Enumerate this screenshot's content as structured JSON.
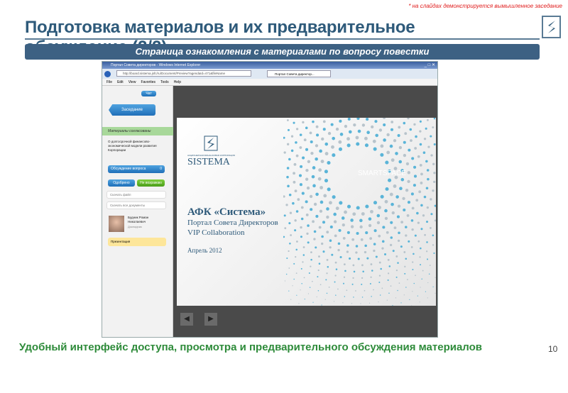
{
  "note": "* на слайдах демонстрируется вымышленное заседание",
  "title_line1": "Подготовка материалов и их предварительное",
  "title_line2": "обсуждение (2/2)",
  "banner": "Страница ознакомления с материалами по вопросу повестки",
  "browser": {
    "window_title": "Портал Совета директоров - Windows Internet Explorer",
    "address": "http://board.sistema.jsfc/ru/Document/Preview?agendaId=471&fileName",
    "tab": "Портал Совета директор...",
    "menu": [
      "File",
      "Edit",
      "View",
      "Favorites",
      "Tools",
      "Help"
    ]
  },
  "portal": {
    "chat": "Чат",
    "meeting": "Заседание",
    "status": "Материалы согласованы",
    "item_title": "О долгосрочной финансово-экономической модели развития Корпорации",
    "discussion": "Обсуждение вопроса",
    "discussion_count": "0",
    "approve": "Одобрено",
    "no_objection": "Не возражаю",
    "download_file": "Скачать файл",
    "download_all": "Скачать все документы",
    "speaker_name": "Будник Роман Николаевич",
    "speaker_role": "Докладчик",
    "presentation": "Презентация"
  },
  "slide": {
    "logo_small": "АКЦИОНЕРНАЯ ФИНАНСОВАЯ КОРПОРАЦИЯ",
    "logo": "SISTEMA",
    "brand": "SMARTSPACE",
    "heading": "АФК «Система»",
    "line1": "Портал Совета Директоров",
    "line2": "VIP Collaboration",
    "date": "Апрель 2012"
  },
  "bottom_text": "Удобный интерфейс доступа, просмотра и предварительного обсуждения материалов",
  "page_number": "10"
}
